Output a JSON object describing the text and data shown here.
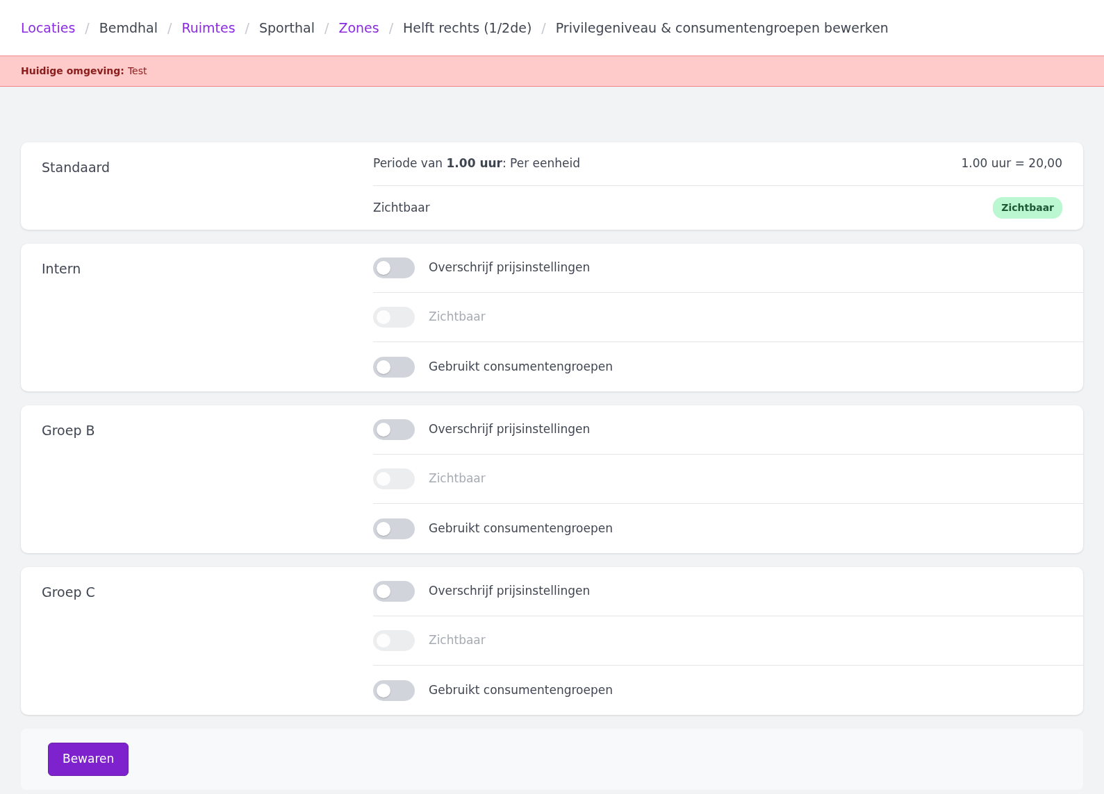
{
  "breadcrumb": [
    {
      "label": "Locaties",
      "kind": "link"
    },
    {
      "separator": "/",
      "label": "Bemdhal",
      "kind": "text"
    },
    {
      "separator": "/",
      "label": "Ruimtes",
      "kind": "link"
    },
    {
      "separator": "/",
      "label": "Sporthal",
      "kind": "text"
    },
    {
      "separator": "/",
      "label": "Zones",
      "kind": "link"
    },
    {
      "separator": "/",
      "label": "Helft rechts (1/2de)",
      "kind": "text"
    },
    {
      "separator": "/",
      "label": "Privilegeniveau & consumentengroepen bewerken",
      "kind": "text"
    }
  ],
  "environment_banner": {
    "label": "Huidige omgeving:",
    "value": "Test"
  },
  "default_card": {
    "title": "Standaard",
    "period": "Periode van **1.00 uur**: Per eenheid",
    "price": "1.00 uur = 20,00",
    "visibility_label": "Zichtbaar",
    "visibility_badge": "Zichtbaar"
  },
  "groups": [
    {
      "title": "Intern",
      "toggles": [
        {
          "label": "Overschrijf prijsinstellingen",
          "checked": false,
          "disabled": false
        },
        {
          "label": "Zichtbaar",
          "checked": false,
          "disabled": true
        },
        {
          "label": "Gebruikt consumentengroepen",
          "checked": false,
          "disabled": false
        }
      ]
    },
    {
      "title": "Groep B",
      "toggles": [
        {
          "label": "Overschrijf prijsinstellingen",
          "checked": false,
          "disabled": false
        },
        {
          "label": "Zichtbaar",
          "checked": false,
          "disabled": true
        },
        {
          "label": "Gebruikt consumentengroepen",
          "checked": false,
          "disabled": false
        }
      ]
    },
    {
      "title": "Groep C",
      "toggles": [
        {
          "label": "Overschrijf prijsinstellingen",
          "checked": false,
          "disabled": false
        },
        {
          "label": "Zichtbaar",
          "checked": false,
          "disabled": true
        },
        {
          "label": "Gebruikt consumentengroepen",
          "checked": false,
          "disabled": false
        }
      ]
    }
  ],
  "save_button": "Bewaren"
}
